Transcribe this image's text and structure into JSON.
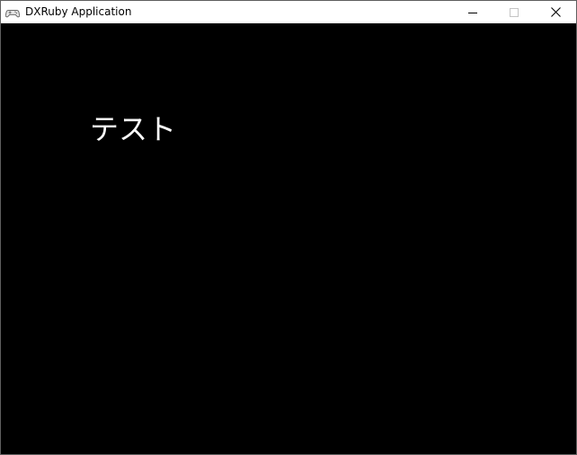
{
  "window": {
    "title": "DXRuby Application",
    "icon": "gamepad-icon",
    "buttons": {
      "minimize": "minimize-icon",
      "maximize": "maximize-icon",
      "close": "close-icon"
    }
  },
  "client": {
    "background": "#000000",
    "text": "テスト",
    "text_color": "#ffffff"
  }
}
